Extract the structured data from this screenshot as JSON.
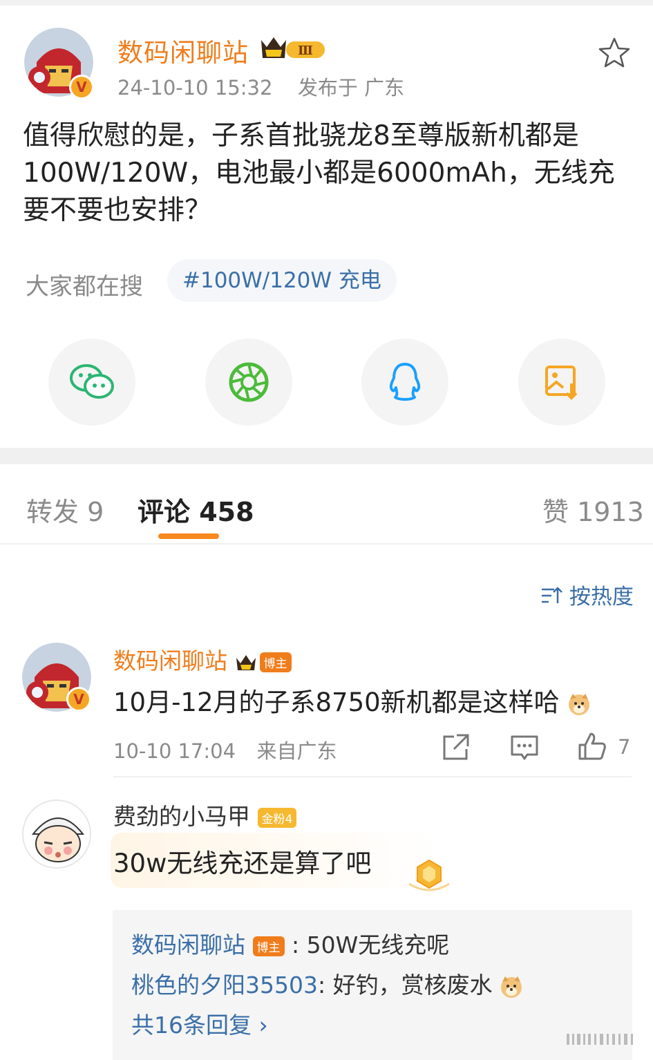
{
  "post": {
    "author": "数码闲聊站",
    "level": "Ⅲ",
    "verified_mark": "V",
    "timestamp": "24-10-10 15:32",
    "location": "发布于 广东",
    "text": "值得欣慰的是，子系首批骁龙8至尊版新机都是100W/120W，电池最小都是6000mAh，无线充要不要也安排？"
  },
  "search": {
    "label": "大家都在搜",
    "chip": "#100W/120W 充电"
  },
  "share": {
    "icons": [
      "wechat-icon",
      "moments-icon",
      "qq-icon",
      "save-image-icon"
    ]
  },
  "tabs": {
    "repost": "转发 9",
    "comments": "评论 458",
    "likes": "赞 1913"
  },
  "sort": {
    "label": "按热度",
    "icon": "sort-icon"
  },
  "comments": [
    {
      "author": "数码闲聊站",
      "badge": "博主",
      "text": "10月-12月的子系8750新机都是这样哈",
      "time": "10-10 17:04",
      "location": "来自广东",
      "likes": "7"
    },
    {
      "author": "费劲的小马甲",
      "badge": "金粉4",
      "text": "30w无线充还是算了吧"
    }
  ],
  "replies": [
    {
      "user": "数码闲聊站",
      "badge": "博主",
      "text": ": 50W无线充呢"
    },
    {
      "user": "桃色的夕阳35503",
      "text": ": 好钓，赏核废水"
    }
  ],
  "replies_more": "共16条回复 ›",
  "colors": {
    "orange": "#f07d1c",
    "blue_link": "#3a6fa8",
    "gray_text": "#8a8a8a",
    "tab_indicator": "#f7891f"
  }
}
